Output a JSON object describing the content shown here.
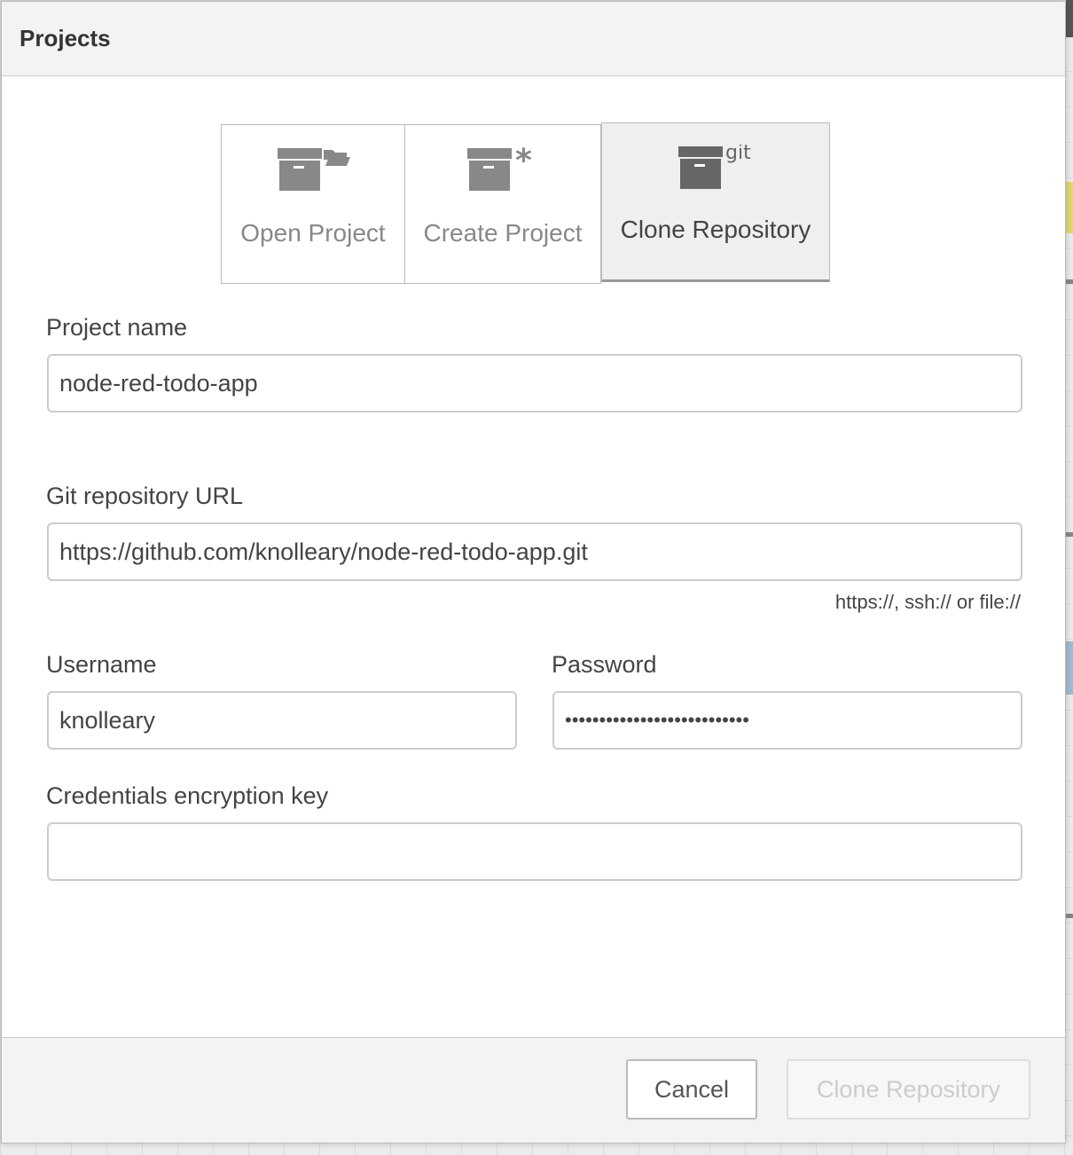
{
  "dialog": {
    "title": "Projects"
  },
  "tabs": [
    {
      "label": "Open Project",
      "icon": "archive-folder-icon"
    },
    {
      "label": "Create Project",
      "icon": "archive-asterisk-icon"
    },
    {
      "label": "Clone Repository",
      "icon": "archive-git-icon",
      "badge": "git",
      "selected": true
    }
  ],
  "form": {
    "project_name": {
      "label": "Project name",
      "value": "node-red-todo-app"
    },
    "git_url": {
      "label": "Git repository URL",
      "value": "https://github.com/knolleary/node-red-todo-app.git",
      "hint": "https://, ssh:// or file://"
    },
    "username": {
      "label": "Username",
      "value": "knolleary"
    },
    "password": {
      "label": "Password",
      "masked": "•••••••••••••••••••••••••••"
    },
    "credentials_key": {
      "label": "Credentials encryption key",
      "value": ""
    }
  },
  "footer": {
    "cancel_label": "Cancel",
    "clone_label": "Clone Repository"
  }
}
